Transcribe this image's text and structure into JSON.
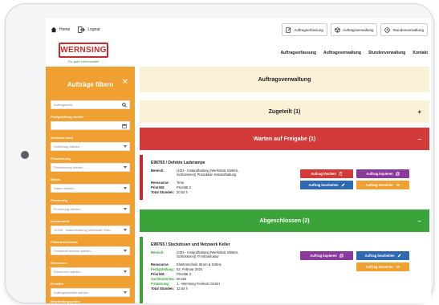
{
  "topbar": {
    "home_label": "Home",
    "logout_label": "Logout",
    "buttons": [
      {
        "label": "Auftragserfassung"
      },
      {
        "label": "Auftragsverwaltung"
      },
      {
        "label": "Stundenverwaltung"
      }
    ]
  },
  "brand": {
    "name": "WERNSING",
    "tagline": "Für gute Lebensmittel"
  },
  "nav": [
    "Auftragserfassung",
    "Auftragsverwaltung",
    "Stundenverwaltung",
    "Kontakt"
  ],
  "sidebar": {
    "title": "Aufträge filtern",
    "search_placeholder": "Auftragsuche",
    "fields": [
      {
        "label": "Fertigstellung von/bis",
        "value": ""
      },
      {
        "label": "Sortieren nach",
        "value": "Sortierung wählen..."
      },
      {
        "label": "Priorisierung",
        "value": "Priorisierung wählen..."
      },
      {
        "label": "Status",
        "value": "Status wählen..."
      },
      {
        "label": "Firmierung",
        "value": "Firmierung wählen..."
      },
      {
        "label": "Kostenstelle",
        "value": "12200 - Instandhaltung (Werkstatt, Elek..."
      },
      {
        "label": "Fehlerart/Ursache",
        "value": "Fehlerart/Ursache wählen..."
      },
      {
        "label": "Ressource",
        "value": "Ressource wählen..."
      },
      {
        "label": "Ersteller",
        "value": "Auftragsersteller wählen..."
      }
    ],
    "bottom_label": "Bearbeitungszeiten"
  },
  "main": {
    "title": "Auftragsverwaltung",
    "sections": [
      {
        "label": "Zugeteilt (1)",
        "sign": "+"
      },
      {
        "label": "Warten auf Freigabe (1)",
        "sign": "–"
      },
      {
        "label": "Abgeschlossen (2)",
        "sign": "–"
      }
    ],
    "card1": {
      "title": "E98765 / Defekte Laderampe",
      "rows": [
        {
          "k": "Bereich:",
          "v": "(23/4 - Instandhaltung (Werkstatt, Elektro, Schlosserei)) Produktion Instandhaltung"
        },
        {
          "k": "Ressource:",
          "v": "Timo"
        },
        {
          "k": "Priorität:",
          "v": "Priorität 2"
        },
        {
          "k": "Total Stunden:",
          "v": "20.52 h"
        }
      ],
      "buttons": {
        "delete": "Auftrag löschen",
        "copy": "Auftrag kopieren",
        "edit": "Auftrag bearbeiten",
        "view": "Auftrag einsehen"
      }
    },
    "card2": {
      "title": "E98765 / Steckdosen und Netzwerk Keller",
      "rows": [
        {
          "k": "Bereich:",
          "v": "(23/4 - Instandhaltung (Werkstatt, Elektro, Schlosserei)) IT-Infrastruktur"
        },
        {
          "k": "Ressource:",
          "v": "Elektrotechnik Strom & Söhne"
        },
        {
          "k": "Fertigstellung:",
          "v": "02. Februar 2024"
        },
        {
          "k": "Priorität:",
          "v": "Priorität 3"
        },
        {
          "k": "Sachkonto/Inv.:",
          "v": "W-254"
        },
        {
          "k": "Firmierung:",
          "v": "1 - Wernsing Feinkost GmbH"
        },
        {
          "k": "Total Stunden:",
          "v": "32.54 h"
        }
      ],
      "buttons": {
        "copy": "Auftrag kopieren",
        "edit": "Auftrag bearbeiten",
        "view": "Auftrag einsehen"
      }
    }
  },
  "colors": {
    "orange": "#f0a030",
    "red": "#c9282d",
    "green": "#3aa33a",
    "purple": "#8b3a9c",
    "blue": "#2f6ab0",
    "cream": "#fbf1d6"
  }
}
